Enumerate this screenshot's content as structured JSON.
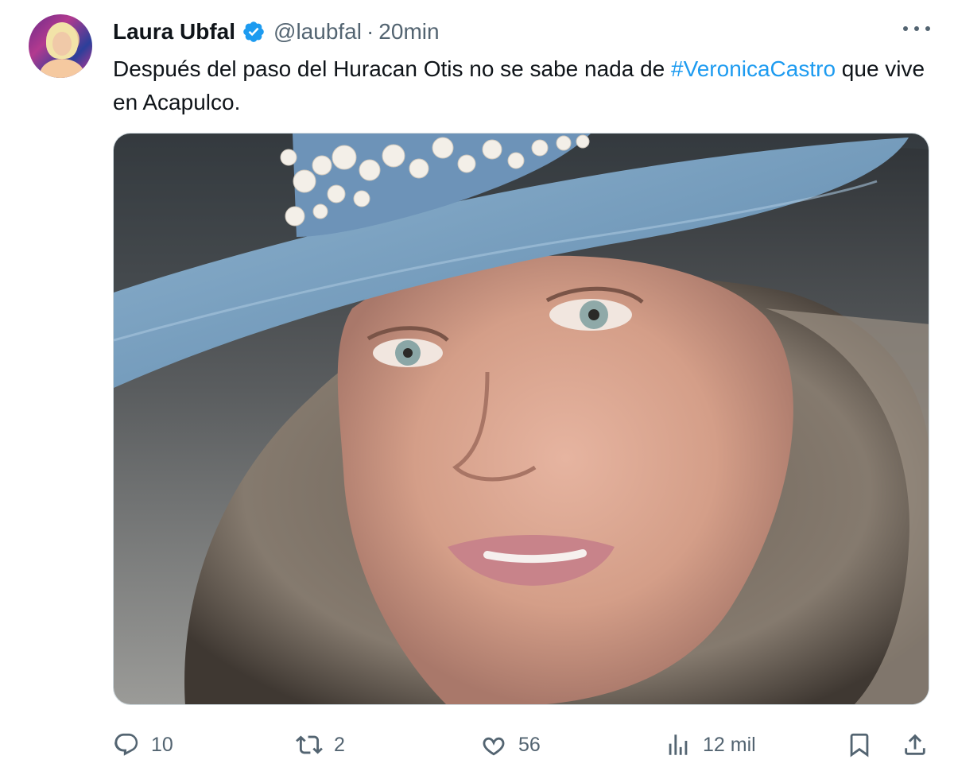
{
  "author": {
    "name": "Laura Ubfal",
    "handle": "@laubfal",
    "separator": "·",
    "time": "20min",
    "verified": true
  },
  "tweet": {
    "text_before": "Después del paso del Huracan Otis no se sabe nada de ",
    "hashtag": "#VeronicaCastro",
    "text_after": " que vive en Acapulco."
  },
  "media": {
    "description_icon": "photo"
  },
  "actions": {
    "replies": "10",
    "retweets": "2",
    "likes": "56",
    "views": "12 mil"
  },
  "colors": {
    "accent": "#1d9bf0",
    "secondary_text": "#536471",
    "primary_text": "#0f1419"
  },
  "icons": {
    "reply": "reply-icon",
    "retweet": "retweet-icon",
    "like": "heart-icon",
    "views": "analytics-icon",
    "bookmark": "bookmark-icon",
    "share": "share-icon",
    "more": "more-icon",
    "verified": "verified-badge-icon"
  }
}
